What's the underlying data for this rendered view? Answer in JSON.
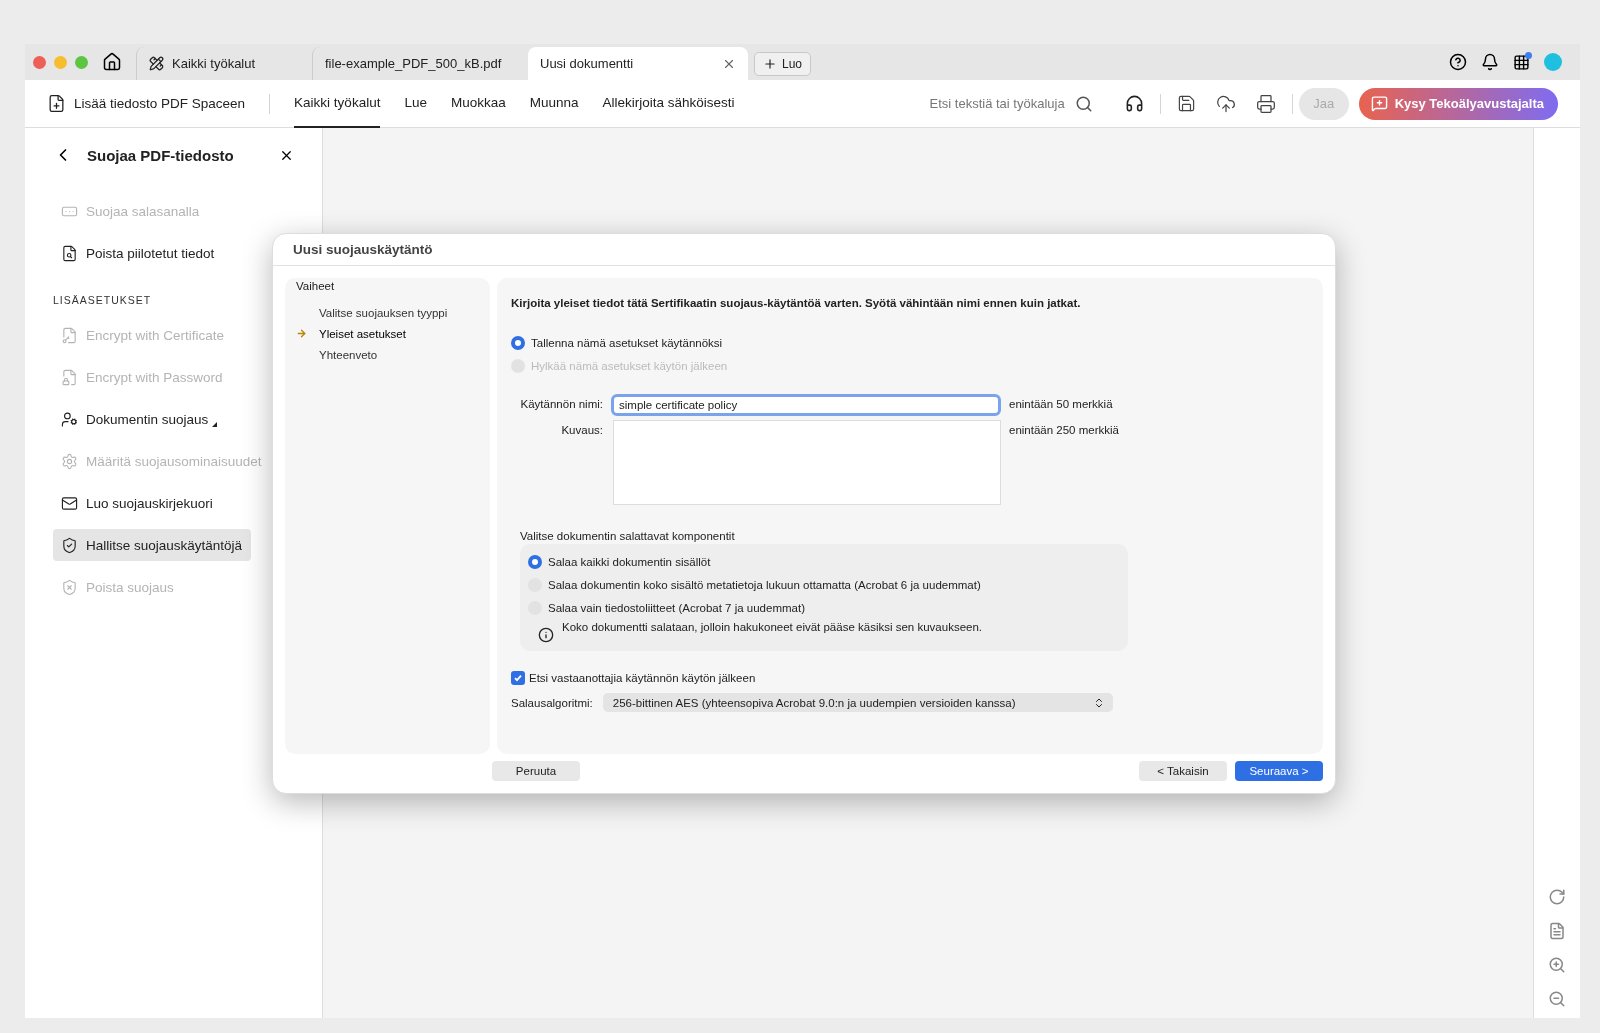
{
  "tabs": [
    {
      "label": "Kaikki työkalut",
      "selected": false,
      "kind": "tools"
    },
    {
      "label": "file-example_PDF_500_kB.pdf",
      "selected": false,
      "kind": "file"
    },
    {
      "label": "Uusi dokumentti",
      "selected": true,
      "kind": "file"
    }
  ],
  "new_tab_button": "Luo",
  "toolbar": {
    "add_button": "Lisää tiedosto PDF Spaceen",
    "nav": [
      {
        "label": "Kaikki työkalut",
        "selected": true
      },
      {
        "label": "Lue",
        "selected": false
      },
      {
        "label": "Muokkaa",
        "selected": false
      },
      {
        "label": "Muunna",
        "selected": false
      },
      {
        "label": "Allekirjoita sähköisesti",
        "selected": false
      }
    ],
    "search": {
      "placeholder": "Etsi tekstiä tai työkaluja"
    },
    "share_button": {
      "label": "Jaa",
      "disabled": true
    },
    "ai_button": "Kysy Tekoälyavustajalta"
  },
  "sidebar": {
    "title": "Suojaa PDF-tiedosto",
    "items": [
      {
        "label": "Suojaa salasanalla",
        "disabled": true,
        "selected": false,
        "submenu": false
      },
      {
        "label": "Poista piilotetut tiedot",
        "disabled": false,
        "selected": false,
        "submenu": false
      }
    ],
    "section_title": "LISÄASETUKSET",
    "advanced_items": [
      {
        "label": "Encrypt with Certificate",
        "disabled": true,
        "selected": false,
        "submenu": false
      },
      {
        "label": "Encrypt with Password",
        "disabled": true,
        "selected": false,
        "submenu": false
      },
      {
        "label": "Dokumentin suojaus",
        "disabled": false,
        "selected": false,
        "submenu": true
      },
      {
        "label": "Määritä suojausominaisuudet",
        "disabled": true,
        "selected": false,
        "submenu": false
      },
      {
        "label": "Luo suojauskirjekuori",
        "disabled": false,
        "selected": false,
        "submenu": false
      },
      {
        "label": "Hallitse suojauskäytäntöjä",
        "disabled": false,
        "selected": true,
        "submenu": false
      },
      {
        "label": "Poista suojaus",
        "disabled": true,
        "selected": false,
        "submenu": false
      }
    ]
  },
  "dialog": {
    "title": "Uusi suojauskäytäntö",
    "steps_title": "Vaiheet",
    "steps": [
      {
        "label": "Valitse suojauksen tyyppi",
        "selected": false
      },
      {
        "label": "Yleiset asetukset",
        "selected": true
      },
      {
        "label": "Yhteenveto",
        "selected": false
      }
    ],
    "intro": "Kirjoita yleiset tiedot tätä Sertifikaatin suojaus-käytäntöä varten. Syötä vähintään nimi ennen kuin jatkat.",
    "save_options": [
      {
        "label": "Tallenna nämä asetukset käytännöksi",
        "selected": true,
        "disabled": false
      },
      {
        "label": "Hylkää nämä asetukset käytön jälkeen",
        "selected": false,
        "disabled": true
      }
    ],
    "name_field": {
      "label": "Käytännön nimi:",
      "value": "simple certificate policy",
      "hint": "enintään 50 merkkiä"
    },
    "description_field": {
      "label": "Kuvaus:",
      "hint": "enintään 250 merkkiä"
    },
    "components_title": "Valitse dokumentin salattavat komponentit",
    "components": [
      {
        "label": "Salaa kaikki dokumentin sisällöt",
        "selected": true
      },
      {
        "label": "Salaa dokumentin koko sisältö metatietoja lukuun ottamatta (Acrobat 6 ja uudemmat)",
        "selected": false
      },
      {
        "label": "Salaa vain tiedostoliitteet (Acrobat 7 ja uudemmat)",
        "selected": false
      }
    ],
    "components_info": "Koko dokumentti salataan, jolloin hakukoneet eivät pääse käsiksi sen kuvaukseen.",
    "recipients_checkbox": {
      "label": "Etsi vastaanottajia käytännön käytön jälkeen",
      "checked": true
    },
    "algorithm": {
      "label": "Salausalgoritmi:",
      "value": "256-bittinen AES (yhteensopiva Acrobat 9.0:n ja uudempien versioiden kanssa)"
    },
    "buttons": {
      "cancel": "Peruuta",
      "back": "< Takaisin",
      "next": "Seuraava >"
    }
  }
}
